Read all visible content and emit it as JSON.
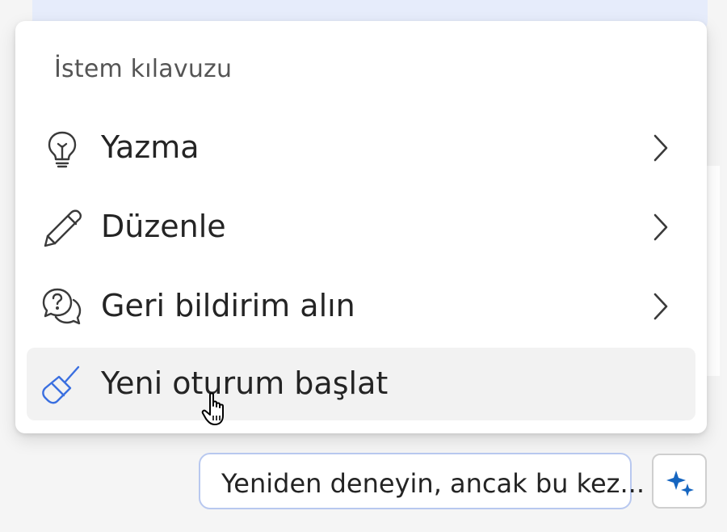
{
  "menu": {
    "heading": "İstem kılavuzu",
    "items": [
      {
        "label": "Yazma",
        "icon": "lightbulb-icon",
        "has_submenu": true
      },
      {
        "label": "Düzenle",
        "icon": "pencil-icon",
        "has_submenu": true
      },
      {
        "label": "Geri bildirim alın",
        "icon": "question-chat-icon",
        "has_submenu": true
      },
      {
        "label": "Yeni oturum başlat",
        "icon": "broom-icon",
        "has_submenu": false,
        "hovered": true
      }
    ]
  },
  "suggestion": {
    "label": "Yeniden deneyin, ancak bu kez..."
  },
  "prompt_button": {
    "icon": "sparkle-icon"
  },
  "colors": {
    "accent_blue": "#3a6fe0",
    "icon_gray": "#3a3a3a",
    "chip_border": "#b8c8ef",
    "sparkle_blue": "#1565c0"
  }
}
